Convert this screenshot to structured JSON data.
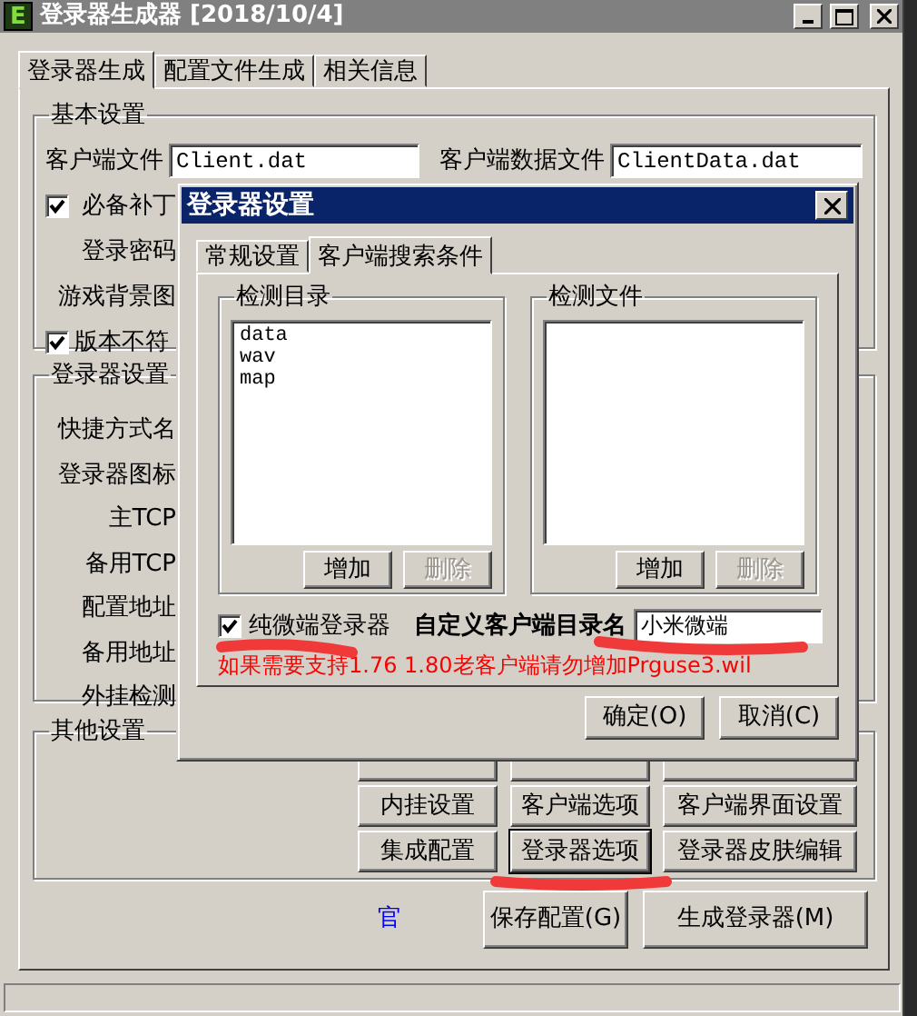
{
  "window": {
    "icon_text": "E",
    "title": "登录器生成器 [2018/10/4]"
  },
  "tabs": [
    {
      "label": "登录器生成",
      "selected": true
    },
    {
      "label": "配置文件生成",
      "selected": false
    },
    {
      "label": "相关信息",
      "selected": false
    }
  ],
  "basic_settings": {
    "title": "基本设置",
    "client_file": {
      "label": "客户端文件",
      "value": "Client.dat"
    },
    "client_data_file": {
      "label": "客户端数据文件",
      "value": "ClientData.dat"
    },
    "required_patch": {
      "label": "必备补丁",
      "checked": true
    },
    "login_password": {
      "label": "登录密码"
    },
    "game_background": {
      "label": "游戏背景图"
    },
    "version_mismatch": {
      "label": "版本不符",
      "checked": true
    }
  },
  "launcher_settings": {
    "title": "登录器设置",
    "labels": [
      "快捷方式名",
      "登录器图标",
      "主TCP",
      "备用TCP",
      "配置地址",
      "备用地址",
      "外挂检测"
    ]
  },
  "other_settings": {
    "title": "其他设置",
    "buttons": [
      {
        "label": "内挂设置",
        "focused": false
      },
      {
        "label": "客户端选项",
        "focused": false
      },
      {
        "label": "客户端界面设置",
        "focused": false
      },
      {
        "label": "集成配置",
        "focused": false
      },
      {
        "label": "登录器选项",
        "focused": true
      },
      {
        "label": "登录器皮肤编辑",
        "focused": false
      }
    ]
  },
  "footer": {
    "link": "官",
    "buttons": [
      "保存配置(G)",
      "生成登录器(M)"
    ]
  },
  "dialog": {
    "title": "登录器设置",
    "tabs": [
      {
        "label": "常规设置",
        "selected": false
      },
      {
        "label": "客户端搜索条件",
        "selected": true
      }
    ],
    "dir_group": {
      "title": "检测目录",
      "items": [
        "data",
        "wav",
        "map"
      ],
      "buttons": [
        {
          "label": "增加",
          "disabled": false
        },
        {
          "label": "删除",
          "disabled": true
        }
      ]
    },
    "file_group": {
      "title": "检测文件",
      "buttons": [
        {
          "label": "增加",
          "disabled": false
        },
        {
          "label": "删除",
          "disabled": true
        }
      ]
    },
    "pure_micro": {
      "label": "纯微端登录器",
      "checked": true
    },
    "custom_dir": {
      "label": "自定义客户端目录名",
      "value": "小米微端"
    },
    "note": "如果需要支持1.76 1.80老客户端请勿增加Prguse3.wil",
    "buttons": [
      "确定(O)",
      "取消(C)"
    ]
  }
}
